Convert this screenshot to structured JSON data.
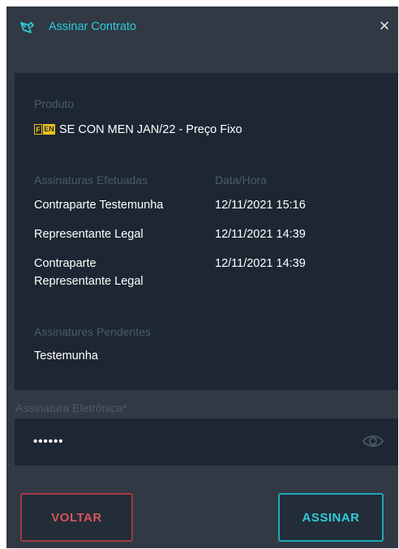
{
  "dialog": {
    "title": "Assinar Contrato",
    "close_label": "×"
  },
  "product": {
    "label": "Produto",
    "badge_left": "F",
    "badge_right": "EN",
    "name": "SE CON MEN JAN/22 - Preço Fixo"
  },
  "signatures_done": {
    "label": "Assinaturas Efetuadas",
    "date_label": "Data/Hora",
    "rows": [
      {
        "role": "Contraparte Testemunha",
        "datetime": "12/11/2021 15:16"
      },
      {
        "role": "Representante Legal",
        "datetime": "12/11/2021 14:39"
      },
      {
        "role_line1": "Contraparte",
        "role_line2": "Representante Legal",
        "datetime": "12/11/2021 14:39"
      }
    ]
  },
  "signatures_pending": {
    "label": "Assinatures Pendentes",
    "items": [
      "Testemunha"
    ]
  },
  "signature_field": {
    "label": "Assinatura Eletrônica*",
    "value": "••••••"
  },
  "actions": {
    "back": "VOLTAR",
    "sign": "ASSINAR"
  },
  "colors": {
    "accent": "#2ecad9",
    "danger": "#d5545b",
    "badge": "#f0c419"
  }
}
